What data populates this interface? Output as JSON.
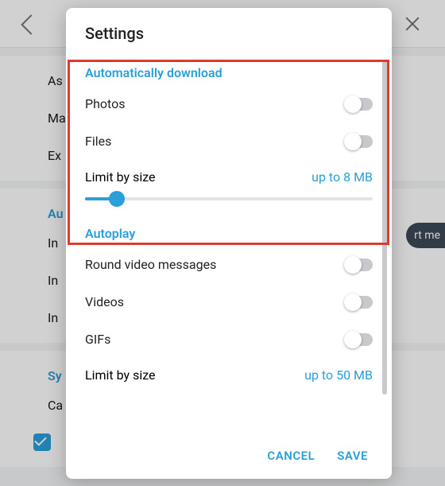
{
  "bg": {
    "rows1": [
      "As",
      "Ma",
      "Ex"
    ],
    "sect_au": "Au",
    "rows2": [
      "In",
      "In",
      "In"
    ],
    "sect_sy": "Sy",
    "row_ca": "Ca",
    "rt_pill": "rt me"
  },
  "modal": {
    "title": "Settings",
    "autodl": {
      "header": "Automatically download",
      "photos": "Photos",
      "files": "Files",
      "limit_label": "Limit by size",
      "limit_value": "up to 8 MB",
      "slider_pct": 11
    },
    "autoplay": {
      "header": "Autoplay",
      "round": "Round video messages",
      "videos": "Videos",
      "gifs": "GIFs",
      "limit_label": "Limit by size",
      "limit_value": "up to 50 MB"
    },
    "cancel": "CANCEL",
    "save": "SAVE"
  }
}
